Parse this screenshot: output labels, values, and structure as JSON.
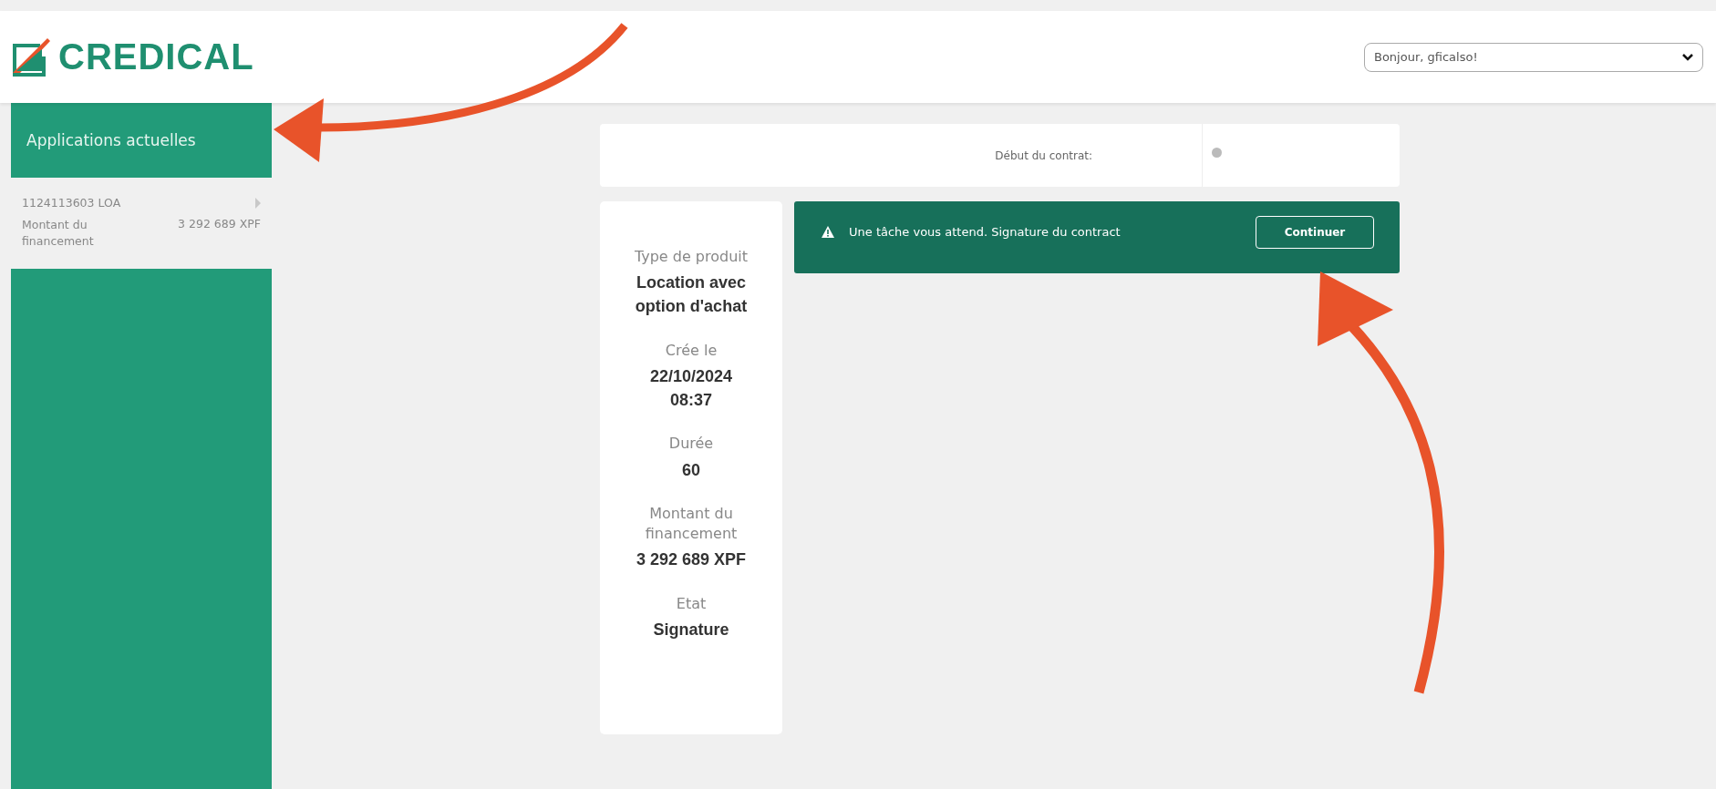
{
  "header": {
    "logo_text": "CREDICAL",
    "user_menu": {
      "value": "Bonjour, gficalso!"
    }
  },
  "sidebar": {
    "title": "Applications actuelles",
    "items": [
      {
        "reference": "1124113603 LOA",
        "label": "Montant du financement",
        "amount": "3 292 689 XPF",
        "selected": true
      }
    ]
  },
  "contract": {
    "start_label": "Début du contrat:"
  },
  "details": [
    {
      "label": "Type de produit",
      "value": "Location avec option d'achat"
    },
    {
      "label": "Crée le",
      "value": "22/10/2024 08:37"
    },
    {
      "label": "Durée",
      "value": "60"
    },
    {
      "label": "Montant du financement",
      "value": "3 292 689 XPF"
    },
    {
      "label": "Etat",
      "value": "Signature"
    }
  ],
  "task_alert": {
    "message": "Une tâche vous attend. Signature du contract",
    "button": "Continuer"
  }
}
